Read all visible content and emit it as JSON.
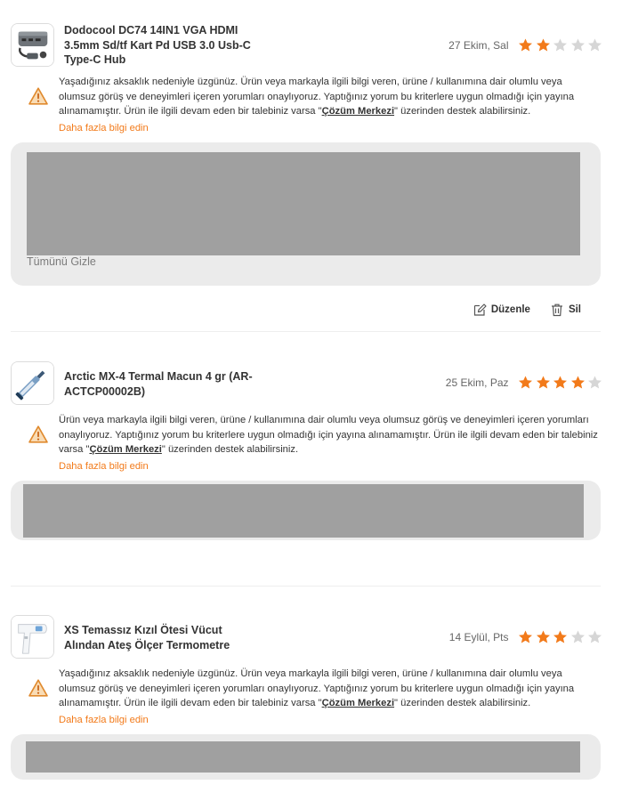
{
  "reviews": [
    {
      "product_name": "Dodocool DC74 14IN1 VGA HDMI 3.5mm Sd/tf Kart Pd USB 3.0 Usb-C Type-C Hub",
      "date": "27 Ekim, Sal",
      "rating": 2,
      "thumb_icon": "usb-hub-icon",
      "message_before": "Yaşadığınız aksaklık nedeniyle üzgünüz. Ürün veya markayla ilgili bilgi veren, ürüne / kullanımına dair olumlu veya olumsuz görüş ve deneyimleri içeren yorumları onaylıyoruz. Yaptığınız yorum bu kriterlere uygun olmadığı için yayına alınamamıştır. Ürün ile ilgili devam eden bir talebiniz varsa \"",
      "message_link": "Çözüm Merkezi",
      "message_after": "\" üzerinden destek alabilirsiniz.",
      "more_link": "Daha fazla bilgi edin",
      "hide_all": "Tümünü Gizle",
      "edit_label": "Düzenle",
      "delete_label": "Sil"
    },
    {
      "product_name": "Arctic MX-4 Termal Macun 4 gr (AR-ACTCP00002B)",
      "date": "25 Ekim, Paz",
      "rating": 4,
      "thumb_icon": "thermal-paste-syringe-icon",
      "message_before": "Ürün veya markayla ilgili bilgi veren, ürüne / kullanımına dair olumlu veya olumsuz görüş ve deneyimleri içeren yorumları onaylıyoruz. Yaptığınız yorum bu kriterlere uygun olmadığı için yayına alınamamıştır. Ürün ile ilgili devam eden bir talebiniz varsa \"",
      "message_link": "Çözüm Merkezi",
      "message_after": "\" üzerinden destek alabilirsiniz.",
      "more_link": "Daha fazla bilgi edin"
    },
    {
      "product_name": "XS Temassız Kızıl Ötesi Vücut Alından Ateş Ölçer Termometre",
      "date": "14 Eylül, Pts",
      "rating": 3,
      "thumb_icon": "infrared-thermometer-icon",
      "message_before": "Yaşadığınız aksaklık nedeniyle üzgünüz. Ürün veya markayla ilgili bilgi veren, ürüne / kullanımına dair olumlu veya olumsuz görüş ve deneyimleri içeren yorumları onaylıyoruz. Yaptığınız yorum bu kriterlere uygun olmadığı için yayına alınamamıştır. Ürün ile ilgili devam eden bir talebiniz varsa \"",
      "message_link": "Çözüm Merkezi",
      "message_after": "\" üzerinden destek alabilirsiniz.",
      "more_link": "Daha fazla bilgi edin"
    }
  ],
  "colors": {
    "accent": "#f27a1a",
    "star_filled": "#f27a1a",
    "star_empty": "#d6d6d6",
    "panel_bg": "#ebebeb",
    "redacted_block": "#a0a0a0"
  }
}
